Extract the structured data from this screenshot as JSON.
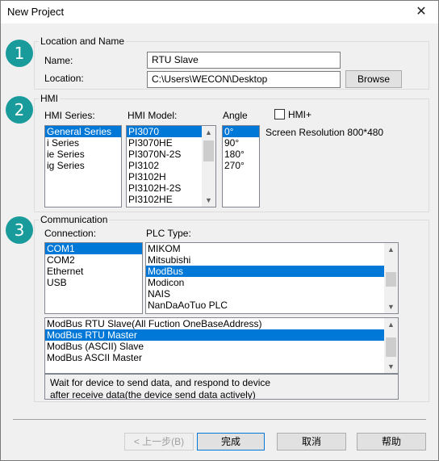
{
  "window": {
    "title": "New Project",
    "close_glyph": "✕"
  },
  "section1": {
    "badge": "1",
    "title": "Location and Name",
    "name_label": "Name:",
    "name_value": "RTU Slave",
    "location_label": "Location:",
    "location_value": "C:\\Users\\WECON\\Desktop",
    "browse_label": "Browse"
  },
  "section2": {
    "badge": "2",
    "title": "HMI",
    "series_label": "HMI Series:",
    "series": [
      "General Series",
      "i Series",
      "ie Series",
      "ig Series"
    ],
    "series_selected": 0,
    "model_label": "HMI Model:",
    "models": [
      "PI3070",
      "PI3070HE",
      "PI3070N-2S",
      "PI3102",
      "PI3102H",
      "PI3102H-2S",
      "PI3102HE"
    ],
    "model_selected": 0,
    "angle_label": "Angle",
    "angles": [
      "0°",
      "90°",
      "180°",
      "270°"
    ],
    "angle_selected": 0,
    "hmi_plus_label": "HMI+",
    "hmi_plus_checked": false,
    "resolution": "Screen Resolution 800*480"
  },
  "section3": {
    "badge": "3",
    "title": "Communication",
    "connection_label": "Connection:",
    "connections": [
      "COM1",
      "COM2",
      "Ethernet",
      "USB"
    ],
    "connection_selected": 0,
    "plc_label": "PLC Type:",
    "plc_types": [
      "MIKOM",
      "Mitsubishi",
      "ModBus",
      "Modicon",
      "NAIS",
      "NanDaAoTuo PLC"
    ],
    "plc_selected": 2,
    "protocols": [
      "ModBus RTU Slave(All Fuction OneBaseAddress)",
      "ModBus RTU Master",
      "ModBus (ASCII) Slave",
      "ModBus ASCII Master"
    ],
    "protocol_selected": 1,
    "description_line1": "Wait for device to send data, and respond to device",
    "description_line2": "after receive data(the device send data actively)"
  },
  "footer": {
    "prev_label": "< 上一步(B)",
    "finish_label": "完成",
    "cancel_label": "取消",
    "help_label": "帮助"
  },
  "colors": {
    "accent": "#0078d7",
    "badge": "#1a9b9b"
  }
}
